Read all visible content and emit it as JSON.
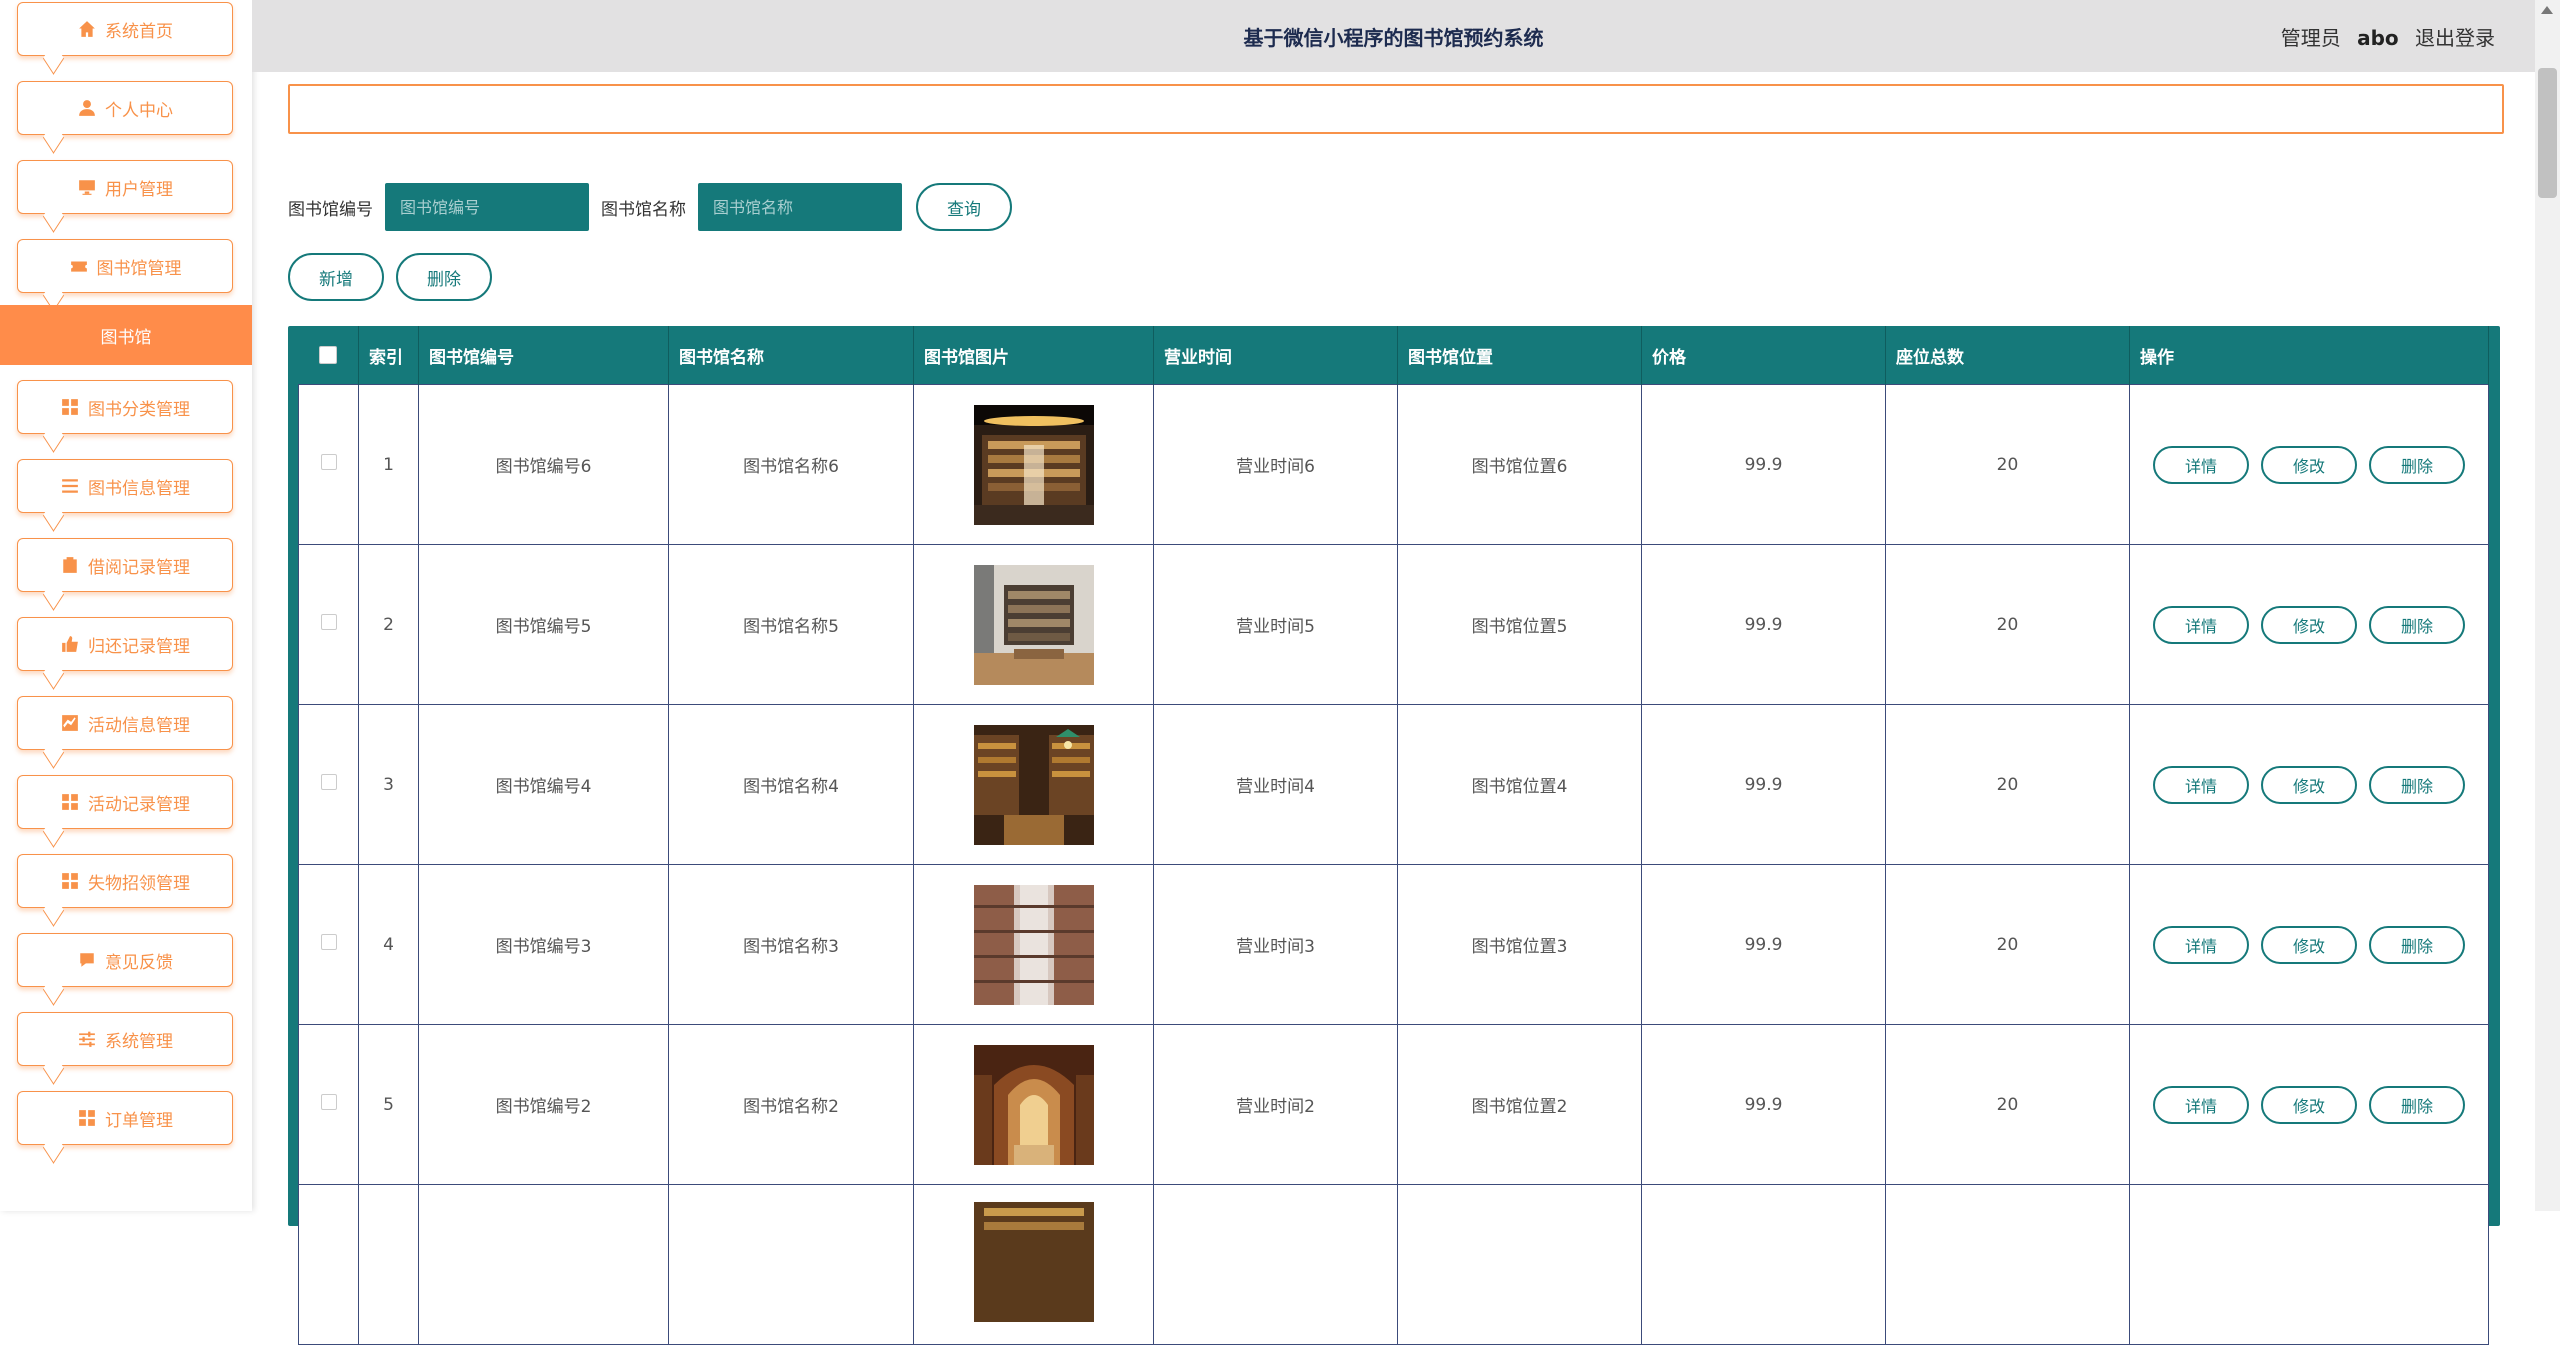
{
  "app": {
    "title": "基于微信小程序的图书馆预约系统",
    "user_role": "管理员",
    "user_name": "abo",
    "logout_label": "退出登录"
  },
  "sidebar": {
    "items": [
      {
        "label": "系统首页",
        "icon": "home-icon"
      },
      {
        "label": "个人中心",
        "icon": "person-icon"
      },
      {
        "label": "用户管理",
        "icon": "monitor-icon"
      },
      {
        "label": "图书馆管理",
        "icon": "ticket-icon"
      },
      {
        "label": "图书分类管理",
        "icon": "grid-icon"
      },
      {
        "label": "图书信息管理",
        "icon": "list-icon"
      },
      {
        "label": "借阅记录管理",
        "icon": "clipboard-icon"
      },
      {
        "label": "归还记录管理",
        "icon": "thumb-icon"
      },
      {
        "label": "活动信息管理",
        "icon": "chart-icon"
      },
      {
        "label": "活动记录管理",
        "icon": "grid-icon"
      },
      {
        "label": "失物招领管理",
        "icon": "grid-icon"
      },
      {
        "label": "意见反馈",
        "icon": "chat-icon"
      },
      {
        "label": "系统管理",
        "icon": "sliders-icon"
      },
      {
        "label": "订单管理",
        "icon": "grid-icon"
      }
    ],
    "active_sub": "图书馆"
  },
  "search": {
    "field1_label": "图书馆编号",
    "field1_placeholder": "图书馆编号",
    "field2_label": "图书馆名称",
    "field2_placeholder": "图书馆名称",
    "query_label": "查询"
  },
  "actions": {
    "add_label": "新增",
    "delete_label": "删除"
  },
  "table": {
    "headers": [
      "索引",
      "图书馆编号",
      "图书馆名称",
      "图书馆图片",
      "营业时间",
      "图书馆位置",
      "价格",
      "座位总数",
      "操作"
    ],
    "rows": [
      {
        "index": "1",
        "code": "图书馆编号6",
        "name": "图书馆名称6",
        "hours": "营业时间6",
        "location": "图书馆位置6",
        "price": "99.9",
        "seats": "20"
      },
      {
        "index": "2",
        "code": "图书馆编号5",
        "name": "图书馆名称5",
        "hours": "营业时间5",
        "location": "图书馆位置5",
        "price": "99.9",
        "seats": "20"
      },
      {
        "index": "3",
        "code": "图书馆编号4",
        "name": "图书馆名称4",
        "hours": "营业时间4",
        "location": "图书馆位置4",
        "price": "99.9",
        "seats": "20"
      },
      {
        "index": "4",
        "code": "图书馆编号3",
        "name": "图书馆名称3",
        "hours": "营业时间3",
        "location": "图书馆位置3",
        "price": "99.9",
        "seats": "20"
      },
      {
        "index": "5",
        "code": "图书馆编号2",
        "name": "图书馆名称2",
        "hours": "营业时间2",
        "location": "图书馆位置2",
        "price": "99.9",
        "seats": "20"
      },
      {
        "index": "",
        "code": "",
        "name": "",
        "hours": "",
        "location": "",
        "price": "",
        "seats": ""
      }
    ],
    "op_detail": "详情",
    "op_edit": "修改",
    "op_delete": "删除"
  },
  "colors": {
    "accent_orange": "#f8924a",
    "teal": "#15797a",
    "header_bg": "#e2e1e2"
  }
}
